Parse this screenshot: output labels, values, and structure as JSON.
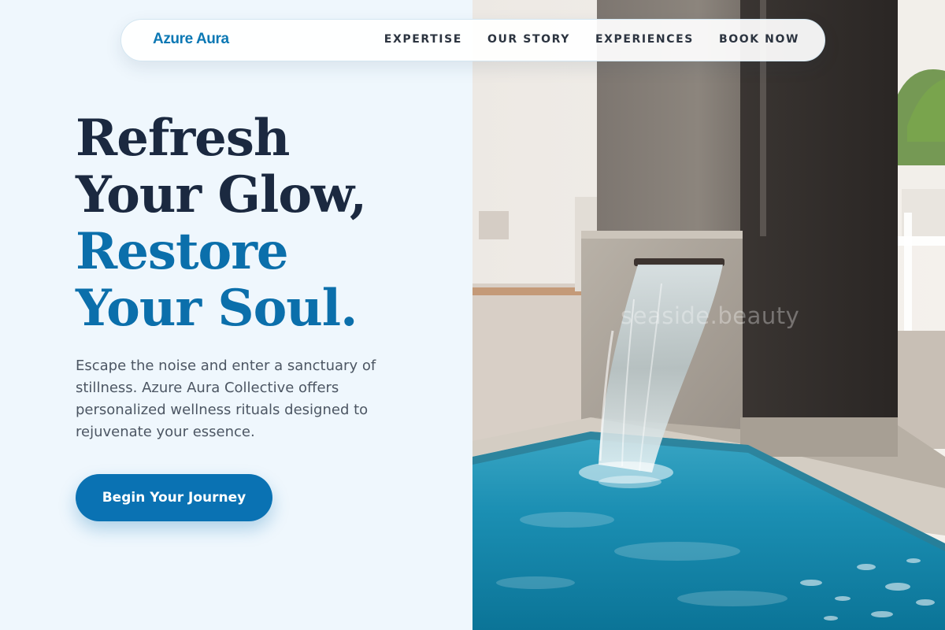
{
  "header": {
    "brand": "Azure Aura",
    "nav": [
      "EXPERTISE",
      "OUR STORY",
      "EXPERIENCES",
      "BOOK NOW"
    ]
  },
  "hero": {
    "headline_line1": "Refresh",
    "headline_line2": "Your Glow,",
    "headline_line3": "Restore",
    "headline_line4": "Your Soul.",
    "subtitle": "Escape the noise and enter a sanctuary of stillness. Azure Aura Collective offers personalized wellness rituals designed to rejuvenate your essence.",
    "cta_label": "Begin Your Journey"
  },
  "photo": {
    "watermark": "seaside.beauty"
  },
  "colors": {
    "background": "#eff7fd",
    "brand": "#0b78b4",
    "headline_dark": "#1b2940",
    "headline_accent": "#0b6fab",
    "button": "#0a72b3",
    "pool_water": "#1c9bbf"
  }
}
